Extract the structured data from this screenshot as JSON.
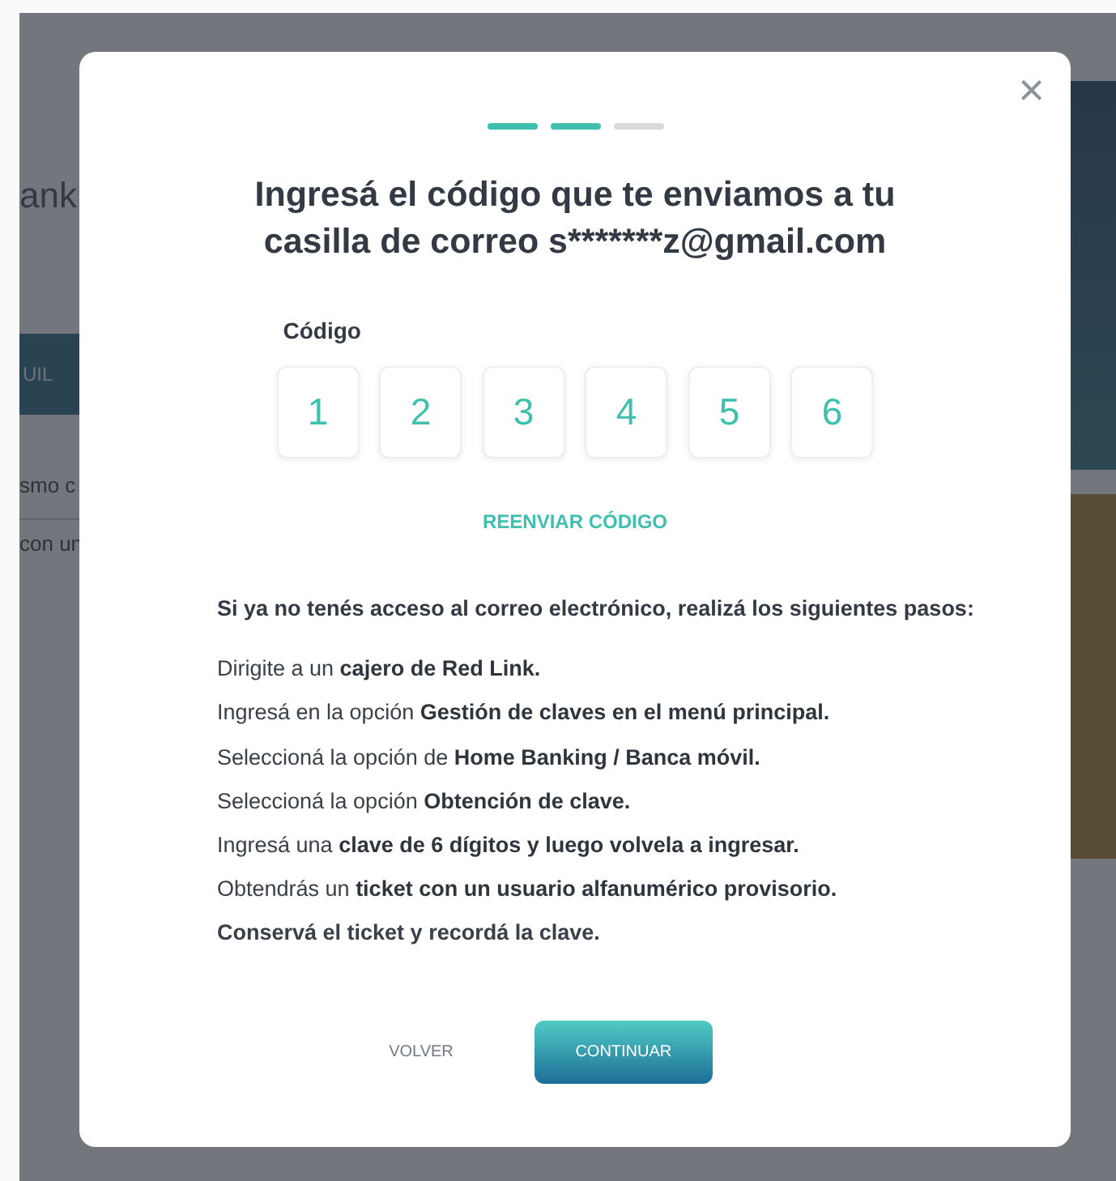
{
  "background_page": {
    "title": "ank",
    "tab": "UIL",
    "text_1": "smo c",
    "text_2": "con un"
  },
  "dialog": {
    "close": "×",
    "steps": [
      {
        "done": true
      },
      {
        "done": true
      },
      {
        "done": false
      }
    ],
    "title": "Ingresá el código que te enviamos a tu casilla de correo s*******z@gmail.com",
    "code_label": "Código",
    "code_digits": [
      "1",
      "2",
      "3",
      "4",
      "5",
      "6"
    ],
    "resend_link": "REENVIAR CÓDIGO",
    "instructions_heading": "Si ya no tenés acceso al correo electrónico, realizá los siguientes pasos:",
    "instructions": [
      {
        "text": "Dirigite a un **cajero de Red Link.**",
        "strong": false
      },
      {
        "text": "Ingresá en la opción **Gestión de claves en el menú principal.**",
        "strong": false
      },
      {
        "text": "Seleccioná la opción de **Home Banking / Banca móvil.**",
        "strong": false
      },
      {
        "text": "Seleccioná la opción **Obtención de clave.**",
        "strong": false
      },
      {
        "text": "Ingresá una **clave de 6 dígitos y luego volvela a ingresar.**",
        "strong": false
      },
      {
        "text": "Obtendrás un **ticket con un usuario alfanumérico provisorio.**",
        "strong": false
      },
      {
        "text": "Conservá el ticket y recordá la clave.",
        "strong": true
      }
    ],
    "back_button": "VOLVER",
    "continue_button": "CONTINUAR"
  }
}
